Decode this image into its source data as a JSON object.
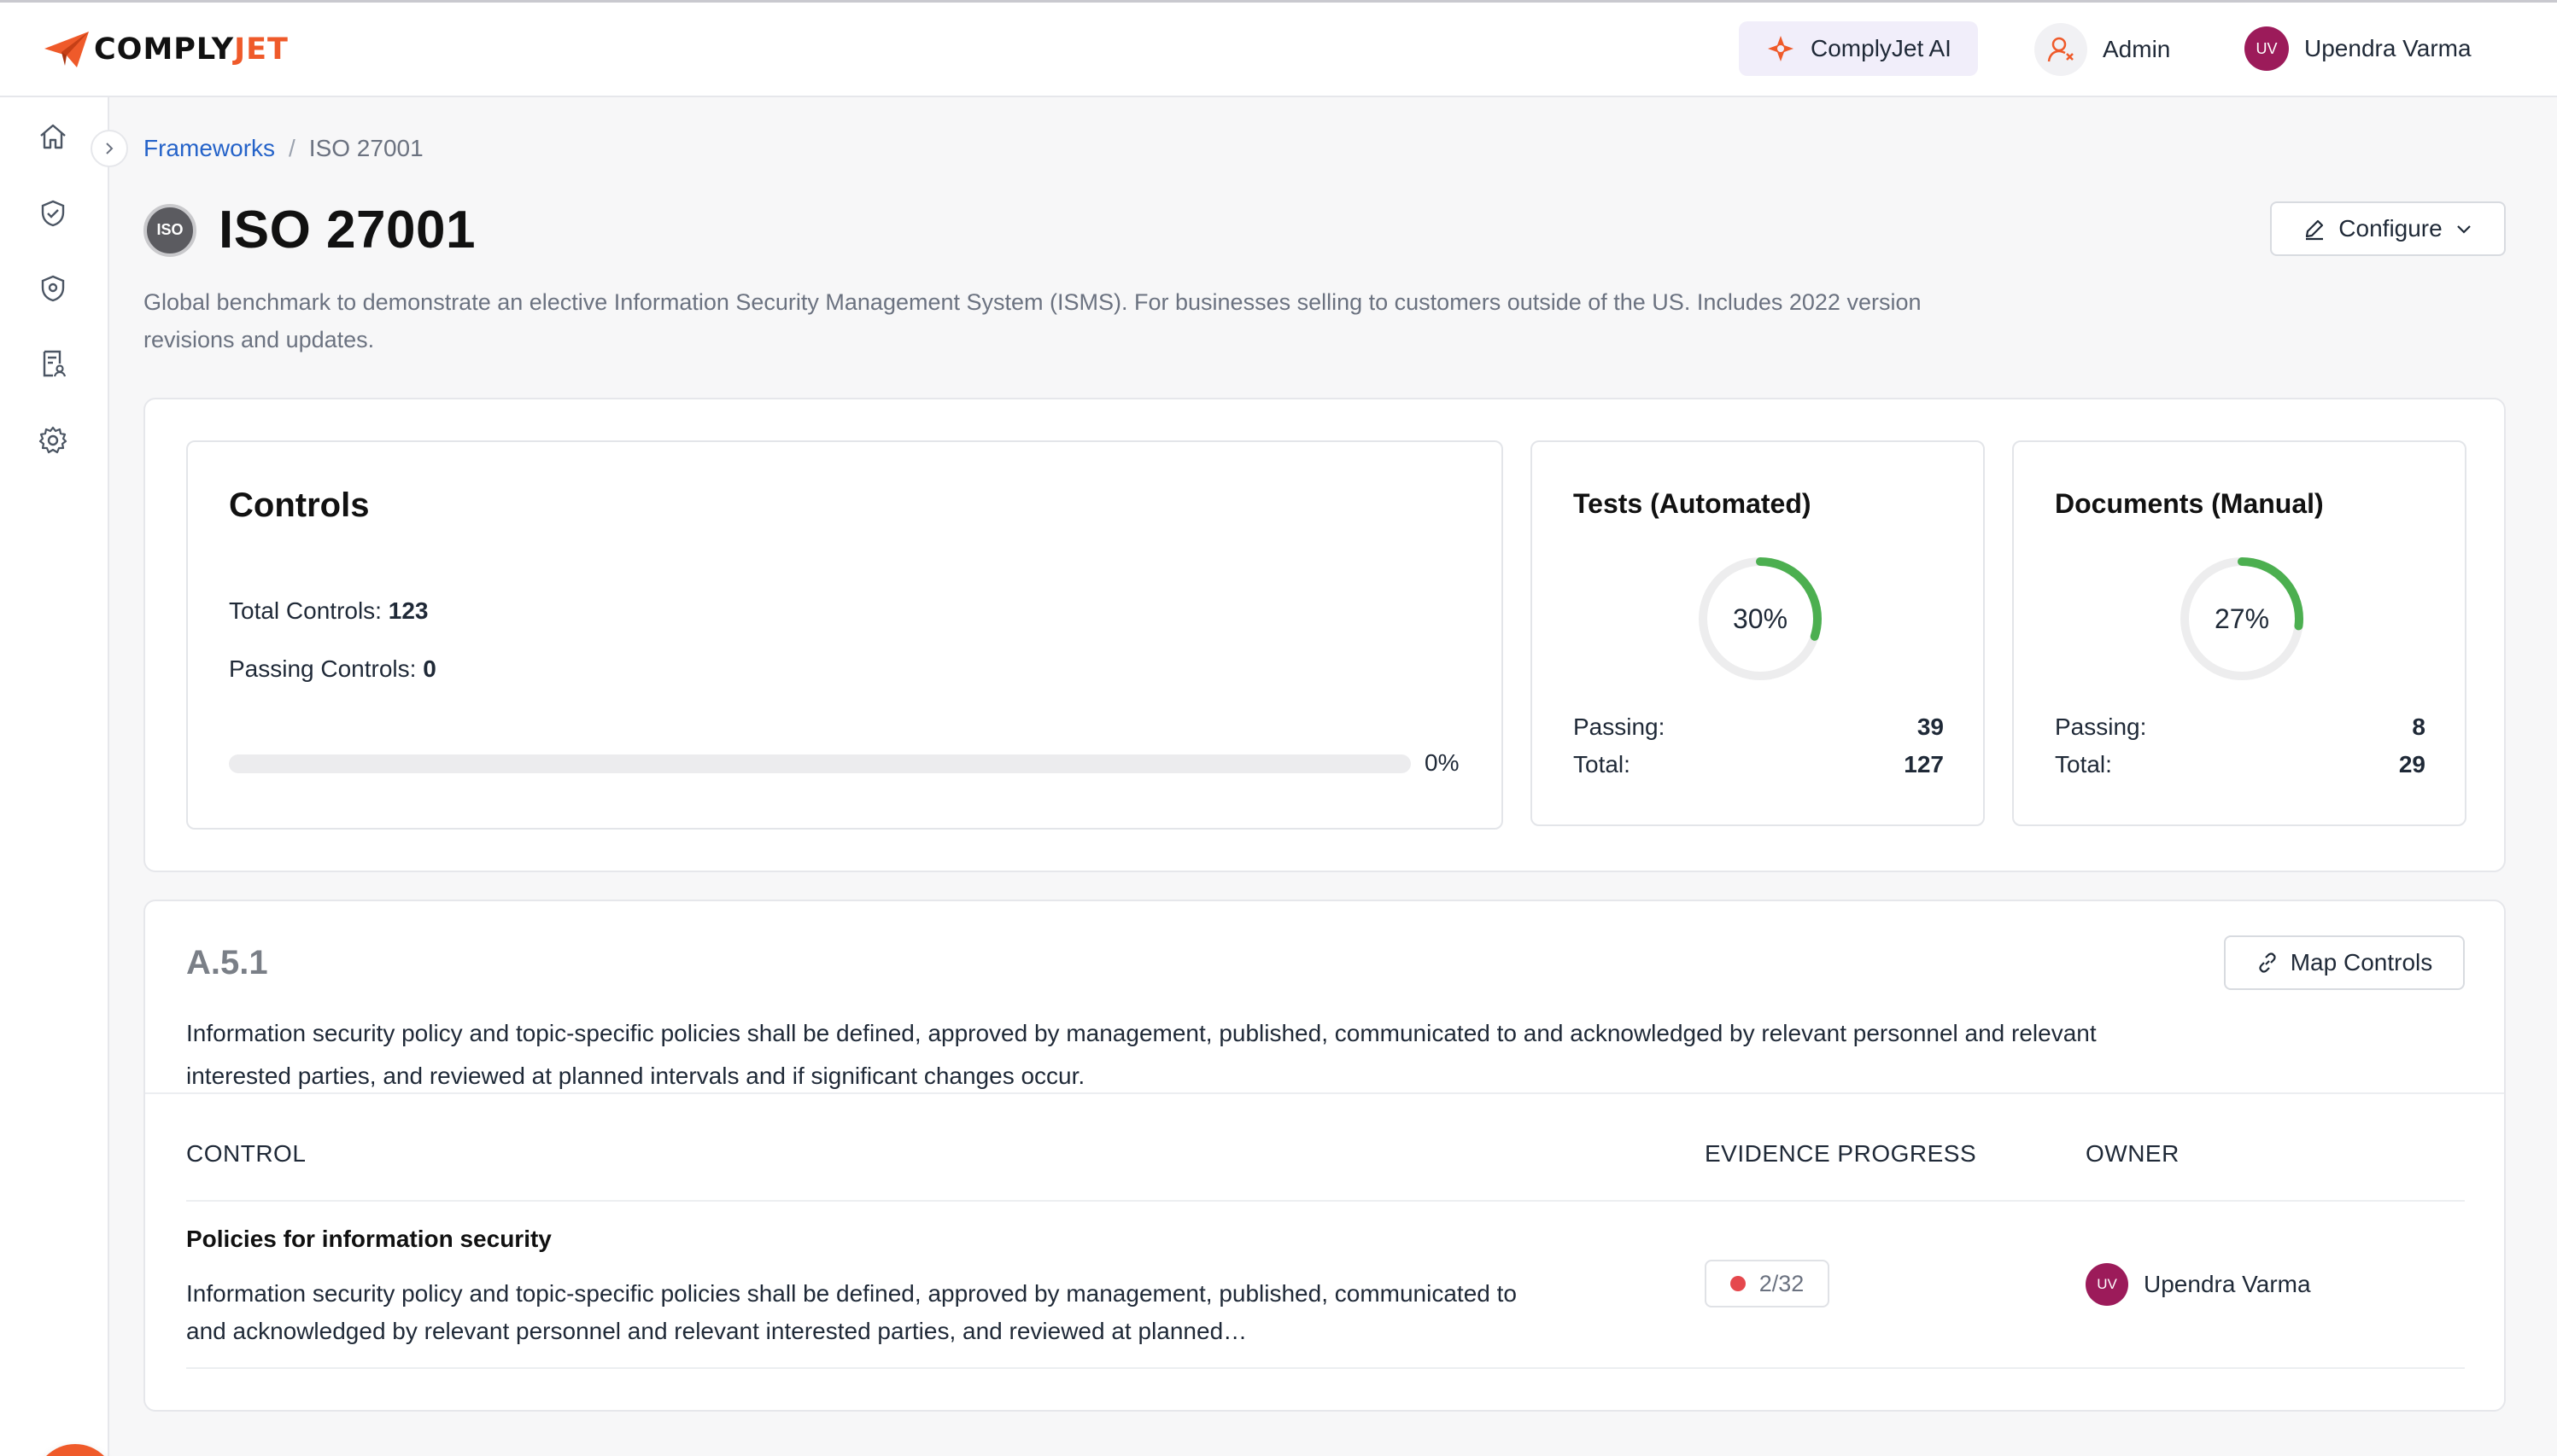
{
  "brand": {
    "name_part1": "COMPLY",
    "name_part2": "JET",
    "accent_color": "#ef5a2a"
  },
  "topbar": {
    "ai_button_label": "ComplyJet AI",
    "admin_label": "Admin",
    "user_initials": "UV",
    "user_name": "Upendra Varma"
  },
  "sidebar": {
    "items": [
      {
        "icon": "home-icon"
      },
      {
        "icon": "shield-check-icon"
      },
      {
        "icon": "shield-lock-icon"
      },
      {
        "icon": "document-user-icon"
      },
      {
        "icon": "gear-icon"
      }
    ]
  },
  "breadcrumb": {
    "parent": "Frameworks",
    "separator": "/",
    "current": "ISO 27001"
  },
  "framework": {
    "badge_text": "ISO",
    "title": "ISO 27001",
    "configure_label": "Configure",
    "description": "Global benchmark to demonstrate an elective Information Security Management System (ISMS). For businesses selling to customers outside of the US. Includes 2022 version revisions and updates."
  },
  "controls": {
    "title": "Controls",
    "total_label": "Total Controls: ",
    "total_value": "123",
    "passing_label": "Passing Controls: ",
    "passing_value": "0",
    "progress_fraction": 0,
    "progress_text": "0%"
  },
  "tests": {
    "title": "Tests (Automated)",
    "percent_text": "30%",
    "percent_value": 30,
    "passing_label": "Passing:",
    "passing_value": "39",
    "total_label": "Total:",
    "total_value": "127"
  },
  "documents": {
    "title": "Documents (Manual)",
    "percent_text": "27%",
    "percent_value": 27,
    "passing_label": "Passing:",
    "passing_value": "8",
    "total_label": "Total:",
    "total_value": "29"
  },
  "requirement": {
    "code": "A.5.1",
    "map_controls_label": "Map Controls",
    "description": "Information security policy and topic-specific policies shall be defined, approved by management, published, communicated to and acknowledged by relevant personnel and relevant interested parties, and reviewed at planned intervals and if significant changes occur.",
    "columns": {
      "control": "CONTROL",
      "evidence": "EVIDENCE PROGRESS",
      "owner": "OWNER"
    },
    "rows": [
      {
        "title": "Policies for information security",
        "description": "Information security policy and topic-specific policies shall be defined, approved by management, published, communicated to and acknowledged by relevant personnel and relevant interested parties, and reviewed at planned…",
        "evidence": "2/32",
        "owner_initials": "UV",
        "owner_name": "Upendra Varma"
      }
    ]
  }
}
